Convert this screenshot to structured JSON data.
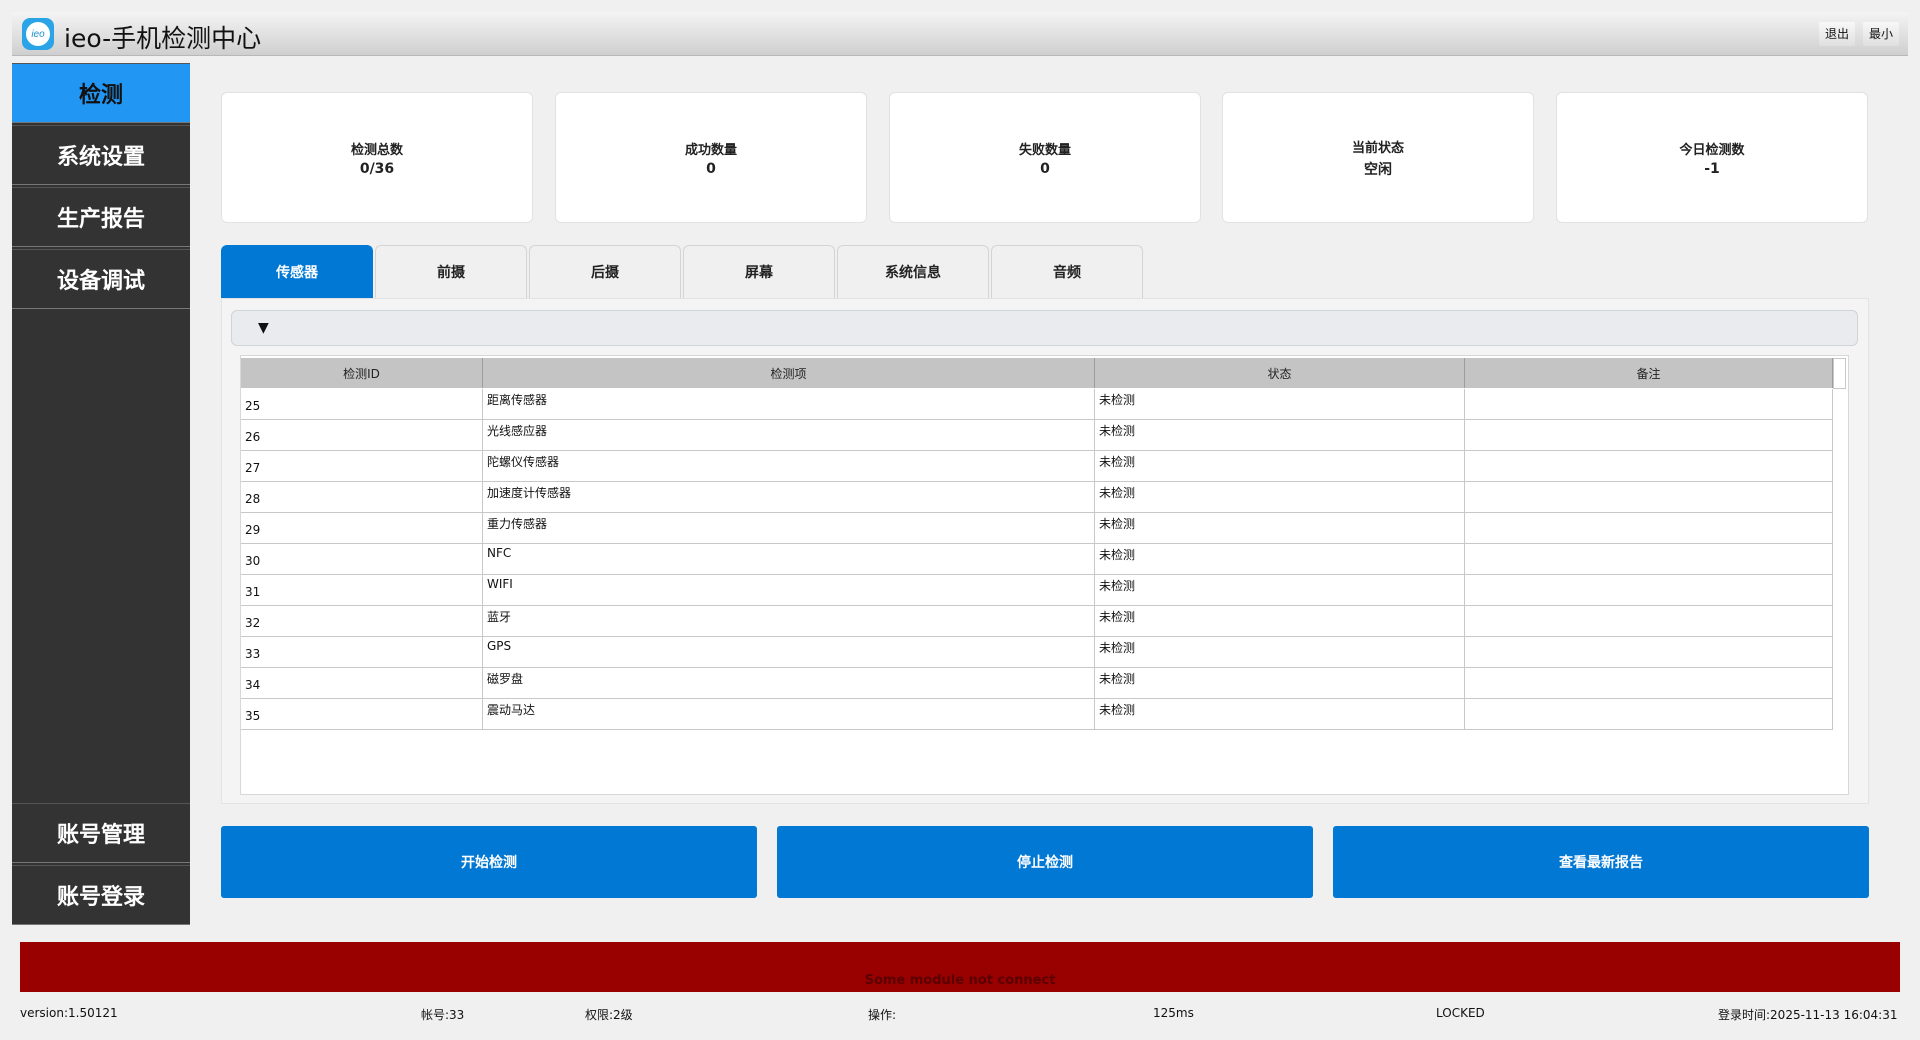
{
  "titlebar": {
    "logo_text": "ieo",
    "title": "ieo-手机检测中心",
    "exit_label": "退出",
    "min_label": "最小"
  },
  "sidebar": {
    "top_items": [
      {
        "label": "检测",
        "active": true
      },
      {
        "label": "系统设置",
        "active": false
      },
      {
        "label": "生产报告",
        "active": false
      },
      {
        "label": "设备调试",
        "active": false
      }
    ],
    "bottom_items": [
      {
        "label": "账号管理"
      },
      {
        "label": "账号登录"
      }
    ]
  },
  "stats": [
    {
      "label": "检测总数",
      "value": "0/36"
    },
    {
      "label": "成功数量",
      "value": "0"
    },
    {
      "label": "失败数量",
      "value": "0"
    },
    {
      "label": "当前状态",
      "value": "空闲"
    },
    {
      "label": "今日检测数",
      "value": "-1"
    }
  ],
  "tabs": [
    {
      "label": "传感器",
      "active": true
    },
    {
      "label": "前摄",
      "active": false
    },
    {
      "label": "后摄",
      "active": false
    },
    {
      "label": "屏幕",
      "active": false
    },
    {
      "label": "系统信息",
      "active": false
    },
    {
      "label": "音频",
      "active": false
    }
  ],
  "collapse_arrow": "▼",
  "table": {
    "columns": [
      "检测ID",
      "检测项",
      "状态",
      "备注"
    ],
    "rows": [
      {
        "id": "25",
        "item": "距离传感器",
        "status": "未检测",
        "note": ""
      },
      {
        "id": "26",
        "item": "光线感应器",
        "status": "未检测",
        "note": ""
      },
      {
        "id": "27",
        "item": "陀螺仪传感器",
        "status": "未检测",
        "note": ""
      },
      {
        "id": "28",
        "item": "加速度计传感器",
        "status": "未检测",
        "note": ""
      },
      {
        "id": "29",
        "item": "重力传感器",
        "status": "未检测",
        "note": ""
      },
      {
        "id": "30",
        "item": "NFC",
        "status": "未检测",
        "note": ""
      },
      {
        "id": "31",
        "item": "WIFI",
        "status": "未检测",
        "note": ""
      },
      {
        "id": "32",
        "item": "蓝牙",
        "status": "未检测",
        "note": ""
      },
      {
        "id": "33",
        "item": "GPS",
        "status": "未检测",
        "note": ""
      },
      {
        "id": "34",
        "item": "磁罗盘",
        "status": "未检测",
        "note": ""
      },
      {
        "id": "35",
        "item": "震动马达",
        "status": "未检测",
        "note": ""
      }
    ]
  },
  "actions": {
    "start": "开始检测",
    "stop": "停止检测",
    "report": "查看最新报告"
  },
  "error_message": "Some module not connect",
  "statusbar": {
    "version": "version:1.50121",
    "account": "帐号:33",
    "permission": "权限:2级",
    "operation": "操作:",
    "latency": "125ms",
    "lock_state": "LOCKED",
    "login_time": "登录时间:2025-11-13 16:04:31"
  },
  "colors": {
    "accent": "#0078d4",
    "nav_active": "#2196f3",
    "sidebar_bg": "#333333",
    "error_bg": "#990000"
  }
}
